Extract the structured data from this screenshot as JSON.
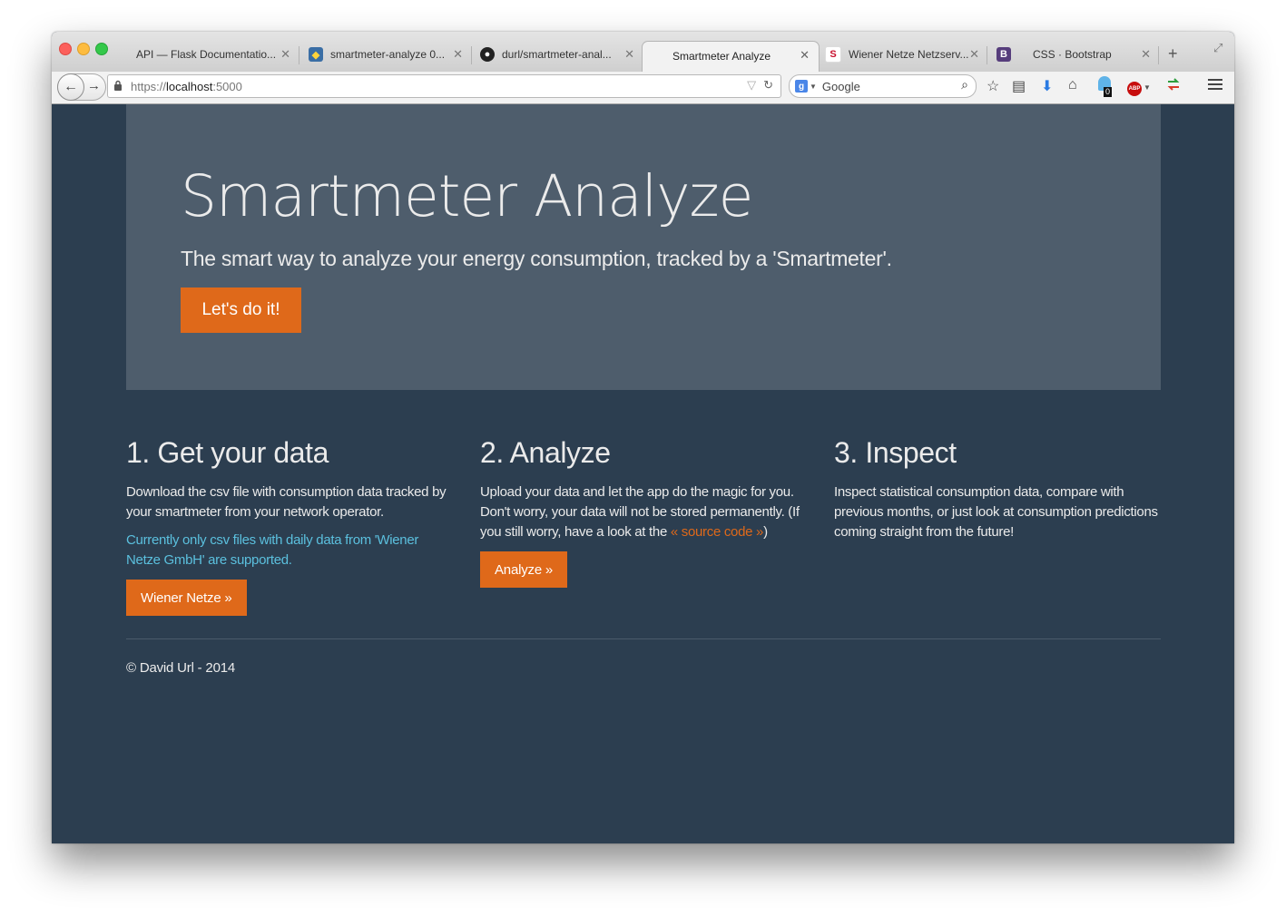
{
  "browser": {
    "tabs": [
      {
        "title": "API — Flask Documentatio...",
        "favicon": "none",
        "active": false
      },
      {
        "title": "smartmeter-analyze 0...",
        "favicon": "python-icon",
        "active": false
      },
      {
        "title": "durl/smartmeter-anal...",
        "favicon": "github-icon",
        "active": false
      },
      {
        "title": "Smartmeter Analyze",
        "favicon": "none",
        "active": true
      },
      {
        "title": "Wiener Netze Netzserv...",
        "favicon": "wiener-netze-icon",
        "active": false
      },
      {
        "title": "CSS · Bootstrap",
        "favicon": "bootstrap-icon",
        "active": false
      }
    ],
    "url": {
      "scheme": "https://",
      "host": "localhost",
      "port": ":5000"
    },
    "search": {
      "engine": "g",
      "placeholder": "Google"
    },
    "ghost_badge_count": "0",
    "abp_label": "ABP"
  },
  "jumbotron": {
    "title": "Smartmeter Analyze",
    "subtitle": "The smart way to analyze your energy consumption, tracked by a 'Smartmeter'.",
    "cta_label": "Let's do it!"
  },
  "columns": [
    {
      "heading": "1. Get your data",
      "text": "Download the csv file with consumption data tracked by your smartmeter from your network operator.",
      "note": "Currently only csv files with daily data from 'Wiener Netze GmbH' are supported.",
      "button_label": "Wiener Netze »"
    },
    {
      "heading": "2. Analyze",
      "text_before": "Upload your data and let the app do the magic for you. Don't worry, your data will not be stored permanently. (If you still worry, have a look at the ",
      "link_label": "« source code »",
      "text_after": ")",
      "button_label": "Analyze »"
    },
    {
      "heading": "3. Inspect",
      "text": "Inspect statistical consumption data, compare with previous months, or just look at consumption predictions coming straight from the future!"
    }
  ],
  "footer": {
    "copyright": "© David Url - 2014"
  },
  "colors": {
    "page_bg": "#2c3e50",
    "jumbotron_bg": "#4e5d6c",
    "accent": "#df691a",
    "info": "#5bc0de",
    "text": "#ebebeb"
  }
}
